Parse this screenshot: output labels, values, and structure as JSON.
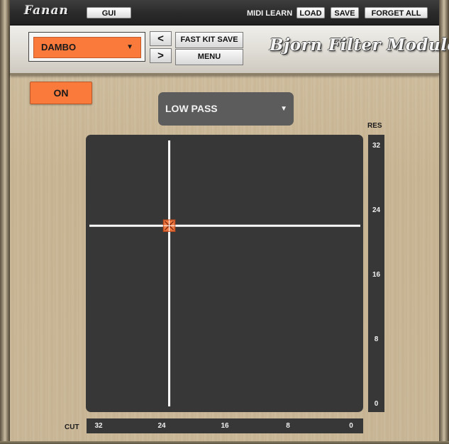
{
  "topbar": {
    "logo_text": "Fanan",
    "gui_label": "GUI",
    "midi_learn_label": "MIDI LEARN",
    "load_label": "LOAD",
    "save_label": "SAVE",
    "forget_all_label": "FORGET ALL"
  },
  "header": {
    "kit_selected": "DAMBO",
    "kit_dropdown_icon": "triangle-down",
    "prev_label": "<",
    "next_label": ">",
    "fast_kit_save_label": "FAST KIT SAVE",
    "menu_label": "MENU",
    "brand_text": "Bjorn Filter Module"
  },
  "controls": {
    "power_label": "ON",
    "filter_type": "LOW PASS",
    "filter_dropdown_icon": "triangle-down"
  },
  "xy_pad": {
    "cut_value": 23,
    "res_value": 22,
    "cut_range": [
      32,
      0
    ],
    "res_range": [
      0,
      32
    ],
    "handle_icon": "crosshair-square"
  },
  "res_axis": {
    "label": "RES",
    "ticks": [
      "32",
      "24",
      "16",
      "8",
      "0"
    ]
  },
  "cut_axis": {
    "label": "CUT",
    "ticks": [
      "32",
      "24",
      "16",
      "8",
      "0"
    ]
  },
  "colors": {
    "accent_orange": "#fa7a3c",
    "pad_dark": "#373737",
    "select_gray": "#5c5c5c"
  }
}
